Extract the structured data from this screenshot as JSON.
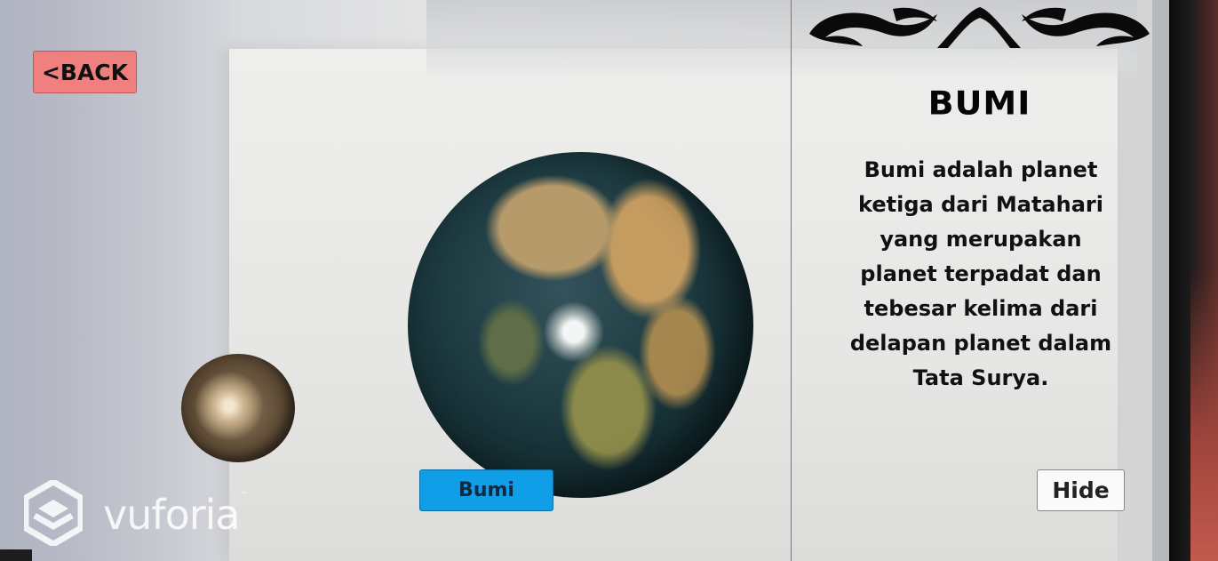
{
  "navigation": {
    "back_label": "<BACK"
  },
  "scene": {
    "planet_label": "Bumi",
    "watermark": {
      "brand": "vuforia",
      "trademark": "™"
    }
  },
  "info_panel": {
    "title": "BUMI",
    "description": "Bumi adalah planet ketiga dari Matahari yang merupakan planet terpadat dan tebesar kelima dari delapan planet dalam Tata Surya.",
    "hide_label": "Hide"
  },
  "colors": {
    "back_button": "#f08080",
    "planet_label_button": "#119ee8",
    "hide_button": "#fafafa"
  }
}
